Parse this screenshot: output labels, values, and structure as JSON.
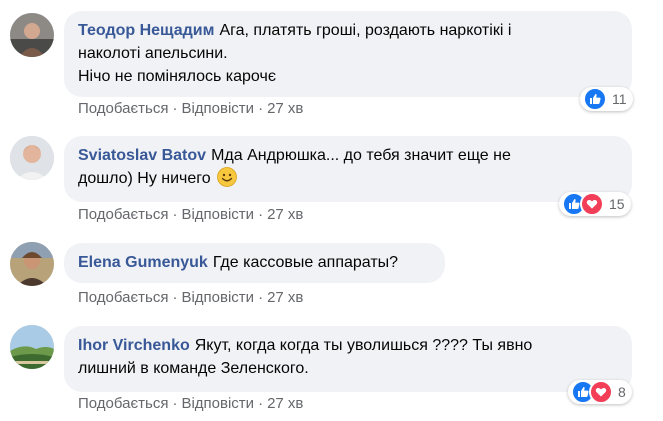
{
  "comments": [
    {
      "author": "Теодор Нещадим",
      "text_lines": [
        "Ага, платять гроші, роздають наркотікі і",
        "наколоті апельсини.",
        "Нічо не помінялось карочє"
      ],
      "like_label": "Подобається",
      "reply_label": "Відповісти",
      "time": "27 хв",
      "reactions": [
        "like-icon"
      ],
      "reaction_count": "11"
    },
    {
      "author": "Sviatoslav Batov",
      "text_lines": [
        "Мда Андрюшка... до тебя значит еще не",
        "дошло) Ну ничего"
      ],
      "emoji": "smile-emoji",
      "like_label": "Подобається",
      "reply_label": "Відповісти",
      "time": "27 хв",
      "reactions": [
        "like-icon",
        "love-icon"
      ],
      "reaction_count": "15"
    },
    {
      "author": "Elena Gumenyuk",
      "text_lines": [
        "Где кассовые аппараты?"
      ],
      "like_label": "Подобається",
      "reply_label": "Відповісти",
      "time": "27 хв"
    },
    {
      "author": "Ihor Virchenko",
      "text_lines": [
        "Якут, когда когда ты уволишься ???? Ты явно",
        "лишний в команде Зеленского."
      ],
      "like_label": "Подобається",
      "reply_label": "Відповісти",
      "time": "27 хв",
      "reactions": [
        "like-icon",
        "love-icon"
      ],
      "reaction_count": "8"
    }
  ],
  "separator": "·",
  "colors": {
    "author": "#385898",
    "bubble": "#f0f2f5",
    "meta": "#65676b",
    "like": "#1877f2",
    "love": "#f33e58"
  }
}
